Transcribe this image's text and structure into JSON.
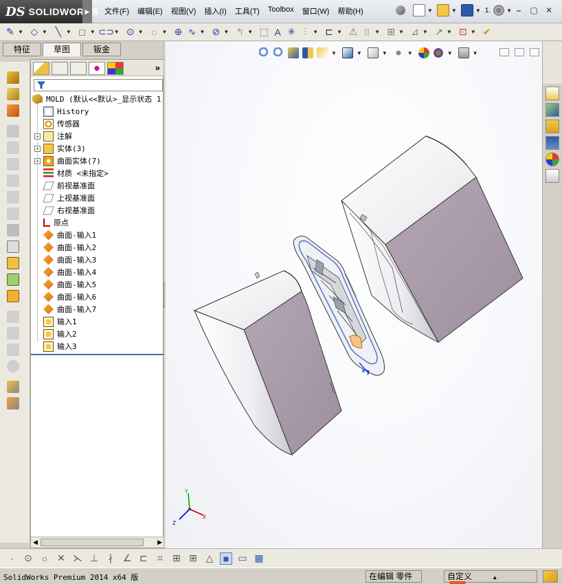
{
  "app": {
    "logo_text": "SOLIDWORKS",
    "logo_mark": "DS"
  },
  "menu": {
    "items": [
      "文件(F)",
      "编辑(E)",
      "视图(V)",
      "插入(I)",
      "工具(T)",
      "Toolbox",
      "窗口(W)",
      "帮助(H)"
    ],
    "quick_tool_label": "1."
  },
  "command_manager": {
    "tabs": [
      "特征",
      "草图",
      "钣金"
    ],
    "active_tab": 1
  },
  "feature_tree": {
    "root_label": "MOLD   (默认<<默认>_显示状态 1",
    "nodes": [
      {
        "label": "History",
        "icon": "history-icon",
        "expandable": false
      },
      {
        "label": "传感器",
        "icon": "sensor-icon",
        "expandable": false
      },
      {
        "label": "注解",
        "icon": "annotation-icon",
        "expandable": true
      },
      {
        "label": "实体(3)",
        "icon": "solid-bodies-icon",
        "expandable": true
      },
      {
        "label": "曲面实体(7)",
        "icon": "surface-bodies-icon",
        "expandable": true
      },
      {
        "label": "材质 <未指定>",
        "icon": "material-icon",
        "expandable": false
      },
      {
        "label": "前视基准面",
        "icon": "plane-icon",
        "expandable": false
      },
      {
        "label": "上视基准面",
        "icon": "plane-icon",
        "expandable": false
      },
      {
        "label": "右视基准面",
        "icon": "plane-icon",
        "expandable": false
      },
      {
        "label": "原点",
        "icon": "origin-icon",
        "expandable": false
      },
      {
        "label": "曲面-输入1",
        "icon": "imported-surface-icon",
        "expandable": false
      },
      {
        "label": "曲面-输入2",
        "icon": "imported-surface-icon",
        "expandable": false
      },
      {
        "label": "曲面-输入3",
        "icon": "imported-surface-icon",
        "expandable": false
      },
      {
        "label": "曲面-输入4",
        "icon": "imported-surface-icon",
        "expandable": false
      },
      {
        "label": "曲面-输入5",
        "icon": "imported-surface-icon",
        "expandable": false
      },
      {
        "label": "曲面-输入6",
        "icon": "imported-surface-icon",
        "expandable": false
      },
      {
        "label": "曲面-输入7",
        "icon": "imported-surface-icon",
        "expandable": false
      },
      {
        "label": "输入1",
        "icon": "imported-body-icon",
        "expandable": false
      },
      {
        "label": "输入2",
        "icon": "imported-body-icon",
        "expandable": false
      },
      {
        "label": "输入3",
        "icon": "imported-body-icon",
        "expandable": false
      }
    ]
  },
  "triad": {
    "x_label": "X",
    "y_label": "Y",
    "z_label": "Z"
  },
  "status": {
    "product": "SolidWorks Premium 2014 x64 版",
    "mode": "在编辑  零件",
    "units": "自定义",
    "units_arrow": "▲"
  },
  "colors": {
    "body_side": "#a89aa8",
    "body_face": "#f2f2f4",
    "accent_blue": "#1f3fa0",
    "highlight": "#3a6ea5"
  }
}
